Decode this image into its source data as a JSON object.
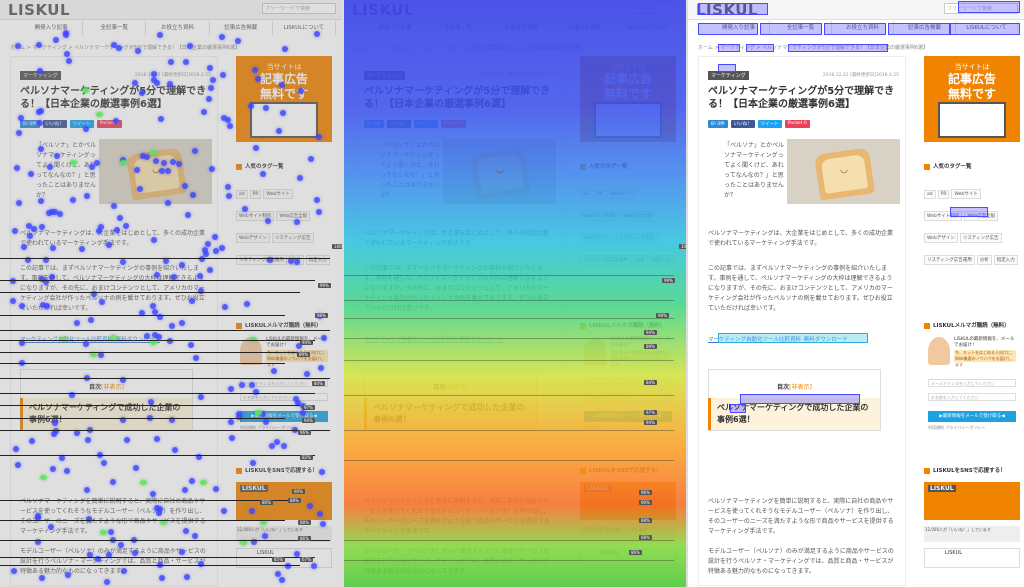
{
  "page": {
    "logo": "LISKUL",
    "search_placeholder": "フリーワードで検索",
    "nav": [
      "開発入り記事",
      "全記事一覧",
      "お役立ち資料",
      "記事広告掲載",
      "LISKULについて"
    ],
    "breadcrumb": "ホーム  >  マーケティング  >  ペルソナマーケティングが5分で理解できる！【日本企業の厳選事例6選】",
    "article": {
      "category": "マーケティング",
      "dates": "2016.12.22    [最終更新日]2018.4.25",
      "title": "ペルソナマーケティングが5分で理解できる！【日本企業の厳選事例6選】",
      "share_buttons": [
        "B! 0件",
        "いいね！",
        "ツイート",
        "Pocket 0"
      ],
      "intro": "「ペルソナ」とかペルソナマーケティングってよく聞くけど、あれってなんなの？」と思ったことはありませんか？",
      "paragraph_1": "ペルソナマーケティングは、大企業をはじめとして、多くの成功企業で使われているマーケティング手法です。",
      "paragraph_2": "この記事では、まずペルソナマーケティングの事例を紹介いたします。事例を通して、ペルソナマーケティングの大枠は理解できるようになりますが、その先に、おまけコンテンツとして、アメリカのマーケティング会社が作ったペルソナの例を載せております。ぜひお役立ていただければ幸いです。",
      "download_link": "マーケティング自動化ツール比較資料_無料ダウンロード",
      "toc_title": "目次",
      "toc_toggle": "[非表示]",
      "toc_item": "1. ペルソナマーケティングで成功した企業の事例6選！",
      "h2": "ペルソナマーケティングで成功した企業の事例6選！",
      "paragraph_3": "ペルソナマーケティングを簡単に説明すると、実際に自社の商品やサービスを使ってくれそうなモデルユーザー（ペルソナ）を作り出し、そのユーザーのニーズを満たすような形で商品やサービスを提供するマーケティング手法です。",
      "paragraph_4": "モデルユーザー（ペルソナ）のみが満足するように商品やサービスの設計を行うペルソナ・マーケティングでは、品質と商品・サービスが特徴ある魅力的なものになってきます。"
    },
    "sidebar": {
      "ad_small": "当サイトは",
      "ad_big_1": "記事広告",
      "ad_big_2": "無料です",
      "tags_title": "人気のタグ一覧",
      "tags": [
        "ad",
        "PR",
        "Webサイト",
        "Webサイト制作",
        "Web広告全般",
        "Webデザイン",
        "リスティング広告",
        "リスティング広告運用",
        "分析",
        "指定入力"
      ],
      "mail_title": "LISKULメルマガ購読（無料）",
      "mail_text": "LISKULの最新情報を、メールでお届け！",
      "mail_orange": "今、ネットをはじめる人向けに、Web集客のノウハウをお届けします",
      "mail_input_1": "メールアドレスを入力してください",
      "mail_input_2": "お名前を入力してください",
      "mail_button": "▶最新情報をメールで受け取る◀",
      "mail_small": "利用規約\nプライバシーポリシー",
      "sns_title": "LISKULをSNSで応援する！",
      "sns_card": "LISKUL",
      "sns_card_sub": "あなたのいいね！が力に",
      "sns_row": "12,000人が「いいね！」しています",
      "sns_liskul": "LISKUL"
    }
  },
  "scroll_markers": [
    "100%",
    "99%",
    "98%",
    "94%",
    "89%",
    "84%",
    "97%",
    "94%",
    "96%",
    "90%",
    "88%",
    "88%",
    "86%",
    "85%",
    "80%",
    "82%",
    "67%"
  ],
  "colors": {
    "accent": "#f08300",
    "link": "#3a7bd5",
    "dot": "#3c46ff",
    "box": "#4a4aff"
  }
}
